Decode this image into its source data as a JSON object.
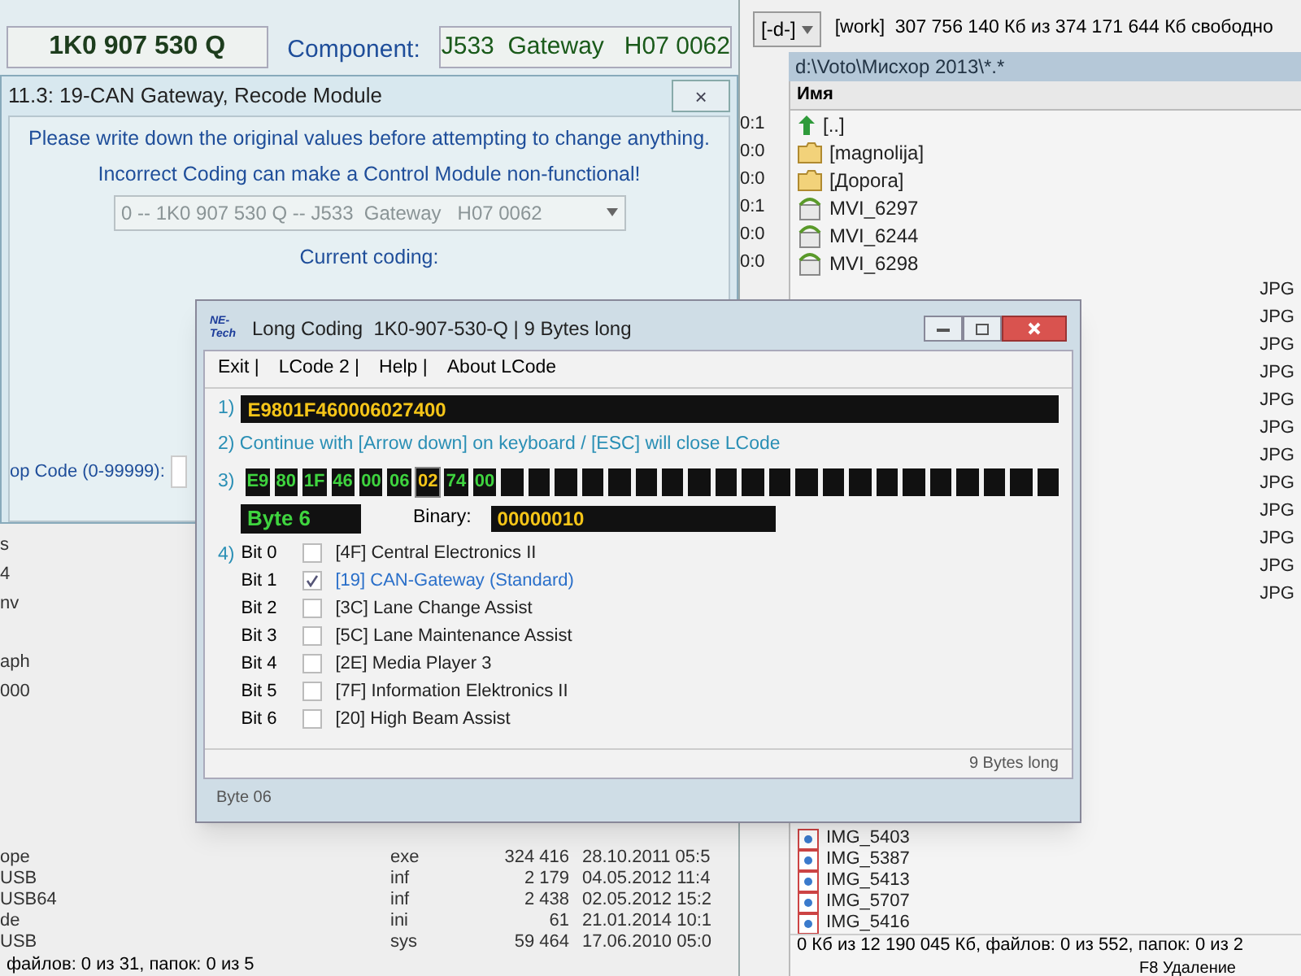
{
  "vcds": {
    "part_number": "1K0 907 530 Q",
    "component_label": "Component:",
    "component": "J533  Gateway   H07 0062",
    "recode_window": {
      "title": "11.3: 19-CAN Gateway,  Recode Module",
      "close": "×",
      "warning_1": "Please write down the original values before attempting to change anything.",
      "warning_2": "Incorrect Coding can make a Control Module non-functional!",
      "module_select": "0 -- 1K0 907 530 Q -- J533  Gateway   H07 0062",
      "current_coding_label": "Current coding:",
      "shop_code_label": "op Code (0-99999):"
    }
  },
  "left_panel": {
    "rows": [
      {
        "name": "s"
      },
      {
        "name": "4"
      },
      {
        "name": "nv"
      },
      {
        "name": ""
      },
      {
        "name": "aph"
      },
      {
        "name": "000"
      },
      {
        "name": ""
      },
      {
        "name": "ope",
        "ext": "exe",
        "size": "324 416",
        "date": "28.10.2011 05:5"
      },
      {
        "name": "USB",
        "ext": "inf",
        "size": "2 179",
        "date": "04.05.2012 11:4"
      },
      {
        "name": "USB64",
        "ext": "inf",
        "size": "2 438",
        "date": "02.05.2012 15:2"
      },
      {
        "name": "de",
        "ext": "ini",
        "size": "61",
        "date": "21.01.2014 10:1"
      },
      {
        "name": "USB",
        "ext": "sys",
        "size": "59 464",
        "date": "17.06.2010 05:0"
      }
    ],
    "status": "файлов: 0 из 31, папок: 0 из 5"
  },
  "right_panel": {
    "drive": "[-d-]",
    "drive_info": "[work]  307 756 140 Кб из 374 171 644 Кб свободно",
    "path": "d:\\Voto\\Мисхор 2013\\*.*",
    "column_name": "Имя",
    "time_fragments": [
      "0:1",
      "0:0",
      "0:0",
      "0:1",
      "0:0",
      "0:0"
    ],
    "rows": [
      {
        "kind": "up",
        "name": "[..]"
      },
      {
        "kind": "folder",
        "name": "[magnolija]"
      },
      {
        "kind": "folder",
        "name": "[Дорога]"
      },
      {
        "kind": "video",
        "name": "MVI_6297"
      },
      {
        "kind": "video",
        "name": "MVI_6244"
      },
      {
        "kind": "video",
        "name": "MVI_6298"
      },
      {
        "kind": "hidden",
        "ext": "JPG"
      },
      {
        "kind": "hidden",
        "ext": "JPG"
      },
      {
        "kind": "hidden",
        "ext": "JPG"
      },
      {
        "kind": "hidden",
        "ext": "JPG"
      },
      {
        "kind": "hidden",
        "ext": "JPG"
      },
      {
        "kind": "hidden",
        "ext": "JPG"
      },
      {
        "kind": "hidden",
        "ext": "JPG"
      },
      {
        "kind": "hidden",
        "ext": "JPG"
      },
      {
        "kind": "hidden",
        "ext": "JPG"
      },
      {
        "kind": "hidden",
        "ext": "JPG"
      },
      {
        "kind": "hidden",
        "ext": "JPG"
      },
      {
        "kind": "hidden",
        "ext": "JPG"
      },
      {
        "kind": "image",
        "name": "IMG_5403"
      },
      {
        "kind": "image",
        "name": "IMG_5387"
      },
      {
        "kind": "image",
        "name": "IMG_5413"
      },
      {
        "kind": "image",
        "name": "IMG_5707"
      },
      {
        "kind": "image",
        "name": "IMG_5416"
      }
    ],
    "status": "0 Кб из 12 190 045 Кб, файлов: 0 из 552, папок: 0 из 2",
    "function_key": "F8 Удаление"
  },
  "lcode": {
    "logo": "NE-Tech",
    "title": "Long Coding  1K0-907-530-Q | 9 Bytes long",
    "menu": [
      "Exit |",
      "LCode 2 |",
      "Help |",
      "About LCode"
    ],
    "step_1": "1)",
    "coding": "E9801F460006027400",
    "step_2": "2) Continue with [Arrow down] on keyboard / [ESC] will close LCode",
    "step_3": "3)",
    "bytes": [
      {
        "value": "E9",
        "selected": false
      },
      {
        "value": "80",
        "selected": false
      },
      {
        "value": "1F",
        "selected": false
      },
      {
        "value": "46",
        "selected": false
      },
      {
        "value": "00",
        "selected": false
      },
      {
        "value": "06",
        "selected": false
      },
      {
        "value": "02",
        "selected": true
      },
      {
        "value": "74",
        "selected": false
      },
      {
        "value": "00",
        "selected": false
      }
    ],
    "byte_label": "Byte 6",
    "binary_label": "Binary:",
    "binary": "00000010",
    "step_4": "4)",
    "bits": [
      {
        "bit": "Bit 0",
        "label": "[4F] Central Electronics II",
        "checked": false
      },
      {
        "bit": "Bit 1",
        "label": "[19] CAN-Gateway (Standard)",
        "checked": true
      },
      {
        "bit": "Bit 2",
        "label": "[3C] Lane Change Assist",
        "checked": false
      },
      {
        "bit": "Bit 3",
        "label": "[5C] Lane Maintenance Assist",
        "checked": false
      },
      {
        "bit": "Bit 4",
        "label": "[2E] Media Player 3",
        "checked": false
      },
      {
        "bit": "Bit 5",
        "label": "[7F] Information Elektronics II",
        "checked": false
      },
      {
        "bit": "Bit 6",
        "label": "[20] High Beam Assist",
        "checked": false
      }
    ],
    "length_note": "9 Bytes long",
    "status": "Byte 06"
  }
}
